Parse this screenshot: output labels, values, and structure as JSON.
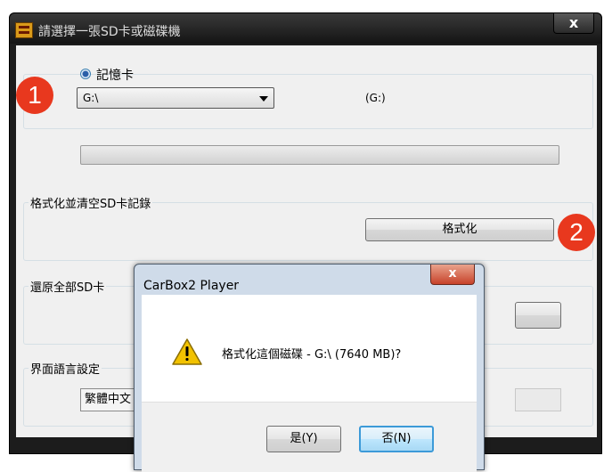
{
  "main_window": {
    "title": "請選擇一張SD卡或磁碟機",
    "close_glyph": "x",
    "radio_label": "記憶卡",
    "drive_select_value": "G:\\",
    "drive_label": "(G:)",
    "progress_fraction": 0,
    "format_group_label": "格式化並清空SD卡記錄",
    "format_button": "格式化",
    "restore_group_label": "還原全部SD卡",
    "language_group_label": "界面語言設定",
    "language_value": "繁體中文"
  },
  "markers": [
    "1",
    "2"
  ],
  "dialog": {
    "title": "CarBox2 Player",
    "close_glyph": "x",
    "message": "格式化這個磁碟 - G:\\ (7640 MB)?",
    "yes_button": "是(Y)",
    "no_button": "否(N)",
    "icon": "warning-icon"
  },
  "colors": {
    "marker": "#e8381e",
    "focus_border": "#3c9ad8",
    "warning": "#f2c200"
  }
}
